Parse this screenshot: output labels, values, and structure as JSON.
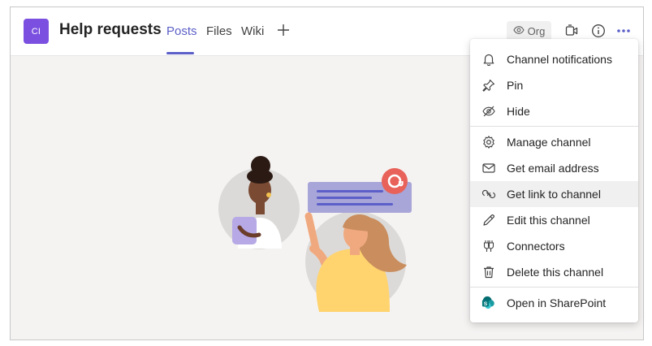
{
  "header": {
    "team_initials": "CI",
    "channel_title": "Help requests",
    "tabs": [
      {
        "label": "Posts",
        "active": true
      },
      {
        "label": "Files",
        "active": false
      },
      {
        "label": "Wiki",
        "active": false
      }
    ],
    "add_tab_icon": "plus-icon",
    "org_label": "Org",
    "icons": [
      "eye-icon",
      "video-call-icon",
      "info-icon",
      "more-options-icon"
    ]
  },
  "menu": {
    "items": [
      {
        "label": "Channel notifications",
        "icon": "bell-icon"
      },
      {
        "label": "Pin",
        "icon": "pin-icon"
      },
      {
        "label": "Hide",
        "icon": "hide-icon"
      },
      {
        "label": "Manage channel",
        "icon": "gear-icon"
      },
      {
        "label": "Get email address",
        "icon": "mail-icon"
      },
      {
        "label": "Get link to channel",
        "icon": "link-icon",
        "hovered": true
      },
      {
        "label": "Edit this channel",
        "icon": "pencil-icon"
      },
      {
        "label": "Connectors",
        "icon": "connectors-icon"
      },
      {
        "label": "Delete this channel",
        "icon": "trash-icon"
      },
      {
        "label": "Open in SharePoint",
        "icon": "sharepoint-icon"
      }
    ]
  },
  "colors": {
    "accent": "#5b5fc7",
    "team_avatar": "#7b4fe0",
    "mention_badge": "#e8625a",
    "sharepoint": "#038387"
  }
}
